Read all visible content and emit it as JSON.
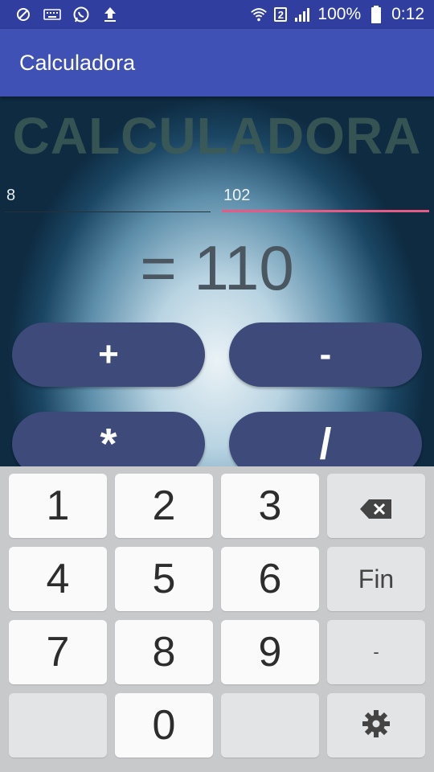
{
  "status_bar": {
    "battery": "100%",
    "time": "0:12",
    "sim_slot": "2",
    "left_icons": [
      "blocked-icon",
      "keyboard-icon",
      "whatsapp-icon",
      "upload-icon"
    ],
    "right_icons": [
      "wifi-icon",
      "sim-icon",
      "signal-icon",
      "battery-icon"
    ]
  },
  "app_bar": {
    "title": "Calculadora"
  },
  "main": {
    "heading": "CALCULADORA",
    "input1": {
      "value": "8"
    },
    "input2": {
      "value": "102"
    },
    "result": "= 110",
    "buttons": {
      "add": "+",
      "subtract": "-",
      "multiply": "*",
      "divide": "/"
    }
  },
  "keyboard": {
    "keys": [
      "1",
      "2",
      "3",
      "4",
      "5",
      "6",
      "7",
      "8",
      "9",
      "0"
    ],
    "fin": "Fin",
    "dash": "-",
    "icons": [
      "backspace-icon",
      "settings-icon"
    ]
  },
  "colors": {
    "status_bar": "#303f9f",
    "app_bar": "#3f51b5",
    "button": "#3d4a7a",
    "focus_underline": "#e85a86"
  }
}
